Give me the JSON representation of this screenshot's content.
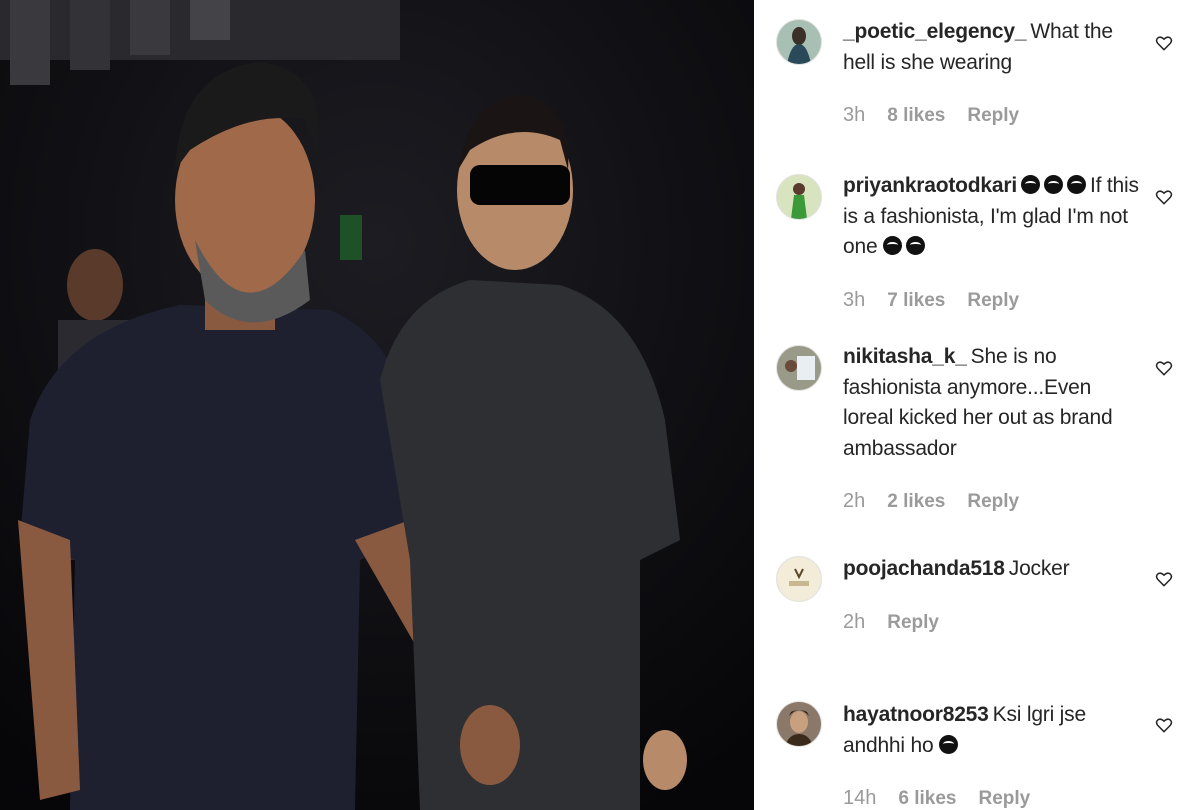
{
  "photo": {
    "description_icon": "photo-couple-walking"
  },
  "comments": [
    {
      "username": "_poetic_elegency_",
      "text": "What the hell is she wearing",
      "time": "3h",
      "likes": "8 likes",
      "reply": "Reply",
      "avatar_color": "#7a9a8a"
    },
    {
      "username": "priyankraotodkari",
      "text_before_emoji": "",
      "text": "If this is a fashionista, I'm glad I'm not one",
      "time": "3h",
      "likes": "7 likes",
      "reply": "Reply",
      "avatar_color": "#6aa04a"
    },
    {
      "username": "nikitasha_k_",
      "text": "She is no fashionista anymore...Even loreal kicked her out as brand ambassador",
      "time": "2h",
      "likes": "2 likes",
      "reply": "Reply",
      "avatar_color": "#8a8a78"
    },
    {
      "username": "poojachanda518",
      "text": "Jocker",
      "time": "2h",
      "likes": "",
      "reply": "Reply",
      "avatar_color": "#eee6d2"
    },
    {
      "username": "hayatnoor8253",
      "text": "Ksi lgri jse andhhi ho",
      "time": "14h",
      "likes": "6 likes",
      "reply": "Reply",
      "avatar_color": "#6a5848"
    }
  ],
  "colors": {
    "text": "#262626",
    "meta": "#9a9a9a",
    "photo_bg": "#0a0a0c"
  }
}
